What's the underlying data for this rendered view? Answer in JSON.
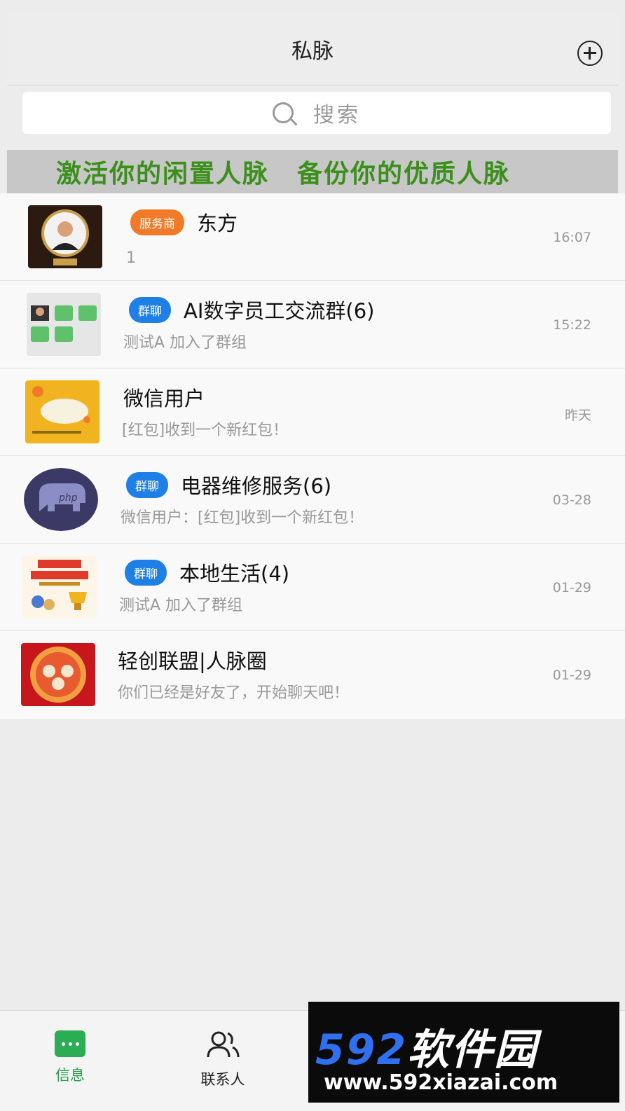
{
  "header": {
    "title": "私脉"
  },
  "search": {
    "placeholder": "搜索"
  },
  "banner": {
    "left": "激活你的闲置人脉",
    "right": "备份你的优质人脉"
  },
  "chats": [
    {
      "tag": "服务商",
      "tag_color": "#f07a28",
      "name": "东方",
      "preview": "1",
      "time": "16:07",
      "avatar": "portrait-avatar"
    },
    {
      "tag": "群聊",
      "tag_color": "#1e7fe6",
      "name": "AI数字员工交流群(6)",
      "preview": "测试A 加入了群组",
      "time": "15:22",
      "avatar": "group-grid-avatar"
    },
    {
      "tag": "",
      "name": "微信用户",
      "preview": "[红包]收到一个新红包！",
      "time": "昨天",
      "avatar": "yellow-cartoon-avatar"
    },
    {
      "tag": "群聊",
      "tag_color": "#1e7fe6",
      "name": "电器维修服务(6)",
      "preview": "微信用户：[红包]收到一个新红包！",
      "time": "03-28",
      "avatar": "php-elephant-avatar"
    },
    {
      "tag": "群聊",
      "tag_color": "#1e7fe6",
      "name": "本地生活(4)",
      "preview": "测试A 加入了群组",
      "time": "01-29",
      "avatar": "recruit-poster-avatar"
    },
    {
      "tag": "",
      "name": "轻创联盟|人脉圈",
      "preview": "你们已经是好友了，开始聊天吧！",
      "time": "01-29",
      "avatar": "red-illustration-avatar"
    }
  ],
  "tabs": [
    {
      "label": "信息",
      "active": true
    },
    {
      "label": "联系人",
      "active": false
    }
  ],
  "watermark": {
    "brand_num": "592",
    "brand_cn": "软件园",
    "url": "www.592xiazai.com"
  },
  "colors": {
    "accent": "#26a04a",
    "banner_text": "#3b8f1b"
  }
}
